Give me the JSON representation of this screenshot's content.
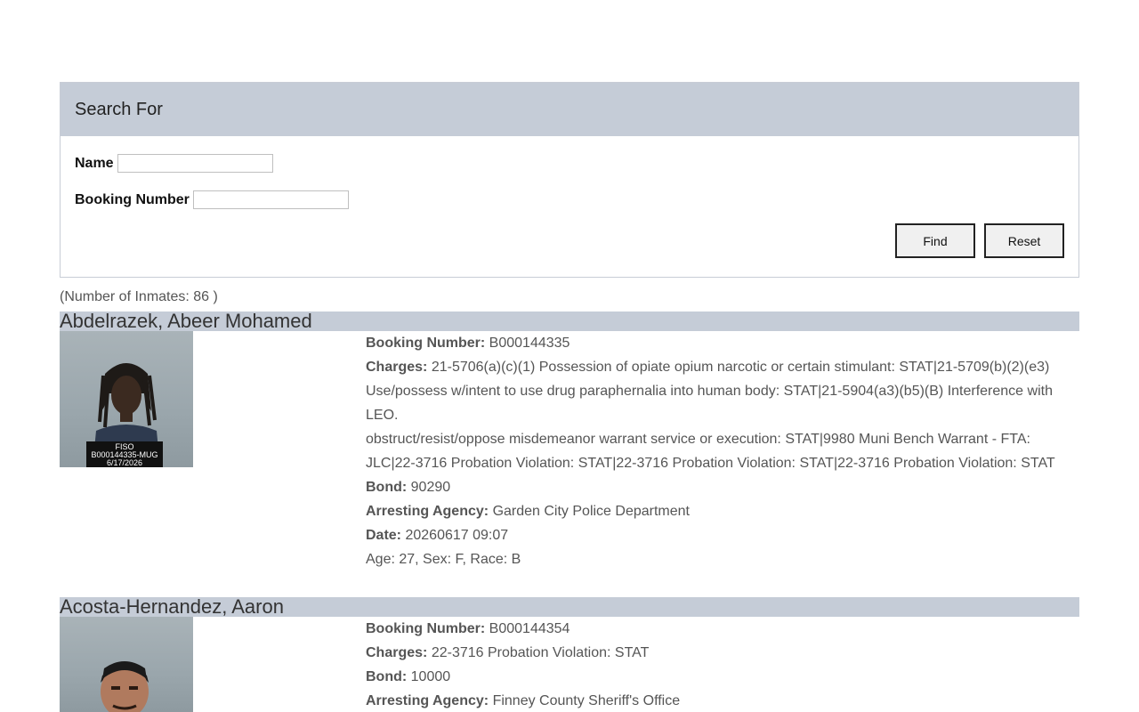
{
  "search": {
    "title": "Search For",
    "name_label": "Name",
    "name_value": "",
    "booking_label": "Booking Number",
    "booking_value": "",
    "find_label": "Find",
    "reset_label": "Reset"
  },
  "results": {
    "count_text": "(Number of Inmates: 86 )"
  },
  "labels": {
    "booking": "Booking Number:",
    "charges": "Charges:",
    "bond": "Bond:",
    "agency": "Arresting Agency:",
    "date": "Date:"
  },
  "inmates": [
    {
      "name": "Abdelrazek, Abeer Mohamed",
      "booking_number": "B000144335",
      "charges_line1": "21-5706(a)(c)(1) Possession of opiate opium narcotic or certain stimulant: STAT|21-5709(b)(2)(e3) Use/possess w/intent to use drug paraphernalia into human body: STAT|21-5904(a3)(b5)(B) Interference with LEO.",
      "charges_line2": "obstruct/resist/oppose misdemeanor warrant service or execution: STAT|9980 Muni Bench Warrant - FTA: JLC|22-3716 Probation Violation: STAT|22-3716 Probation Violation: STAT|22-3716 Probation Violation: STAT",
      "bond": "90290",
      "agency": "Garden City Police Department",
      "date": "20260617 09:07",
      "demographics": "Age: 27, Sex: F, Race: B",
      "placard_line1": "FISO",
      "placard_line2": "B000144335-MUG",
      "placard_line3": "6/17/2026"
    },
    {
      "name": "Acosta-Hernandez, Aaron",
      "booking_number": "B000144354",
      "charges_line1": "22-3716 Probation Violation: STAT",
      "bond": "10000",
      "agency": "Finney County Sheriff's Office"
    }
  ],
  "colors": {
    "header_bg": "#c5ccd7",
    "text": "#555555"
  }
}
